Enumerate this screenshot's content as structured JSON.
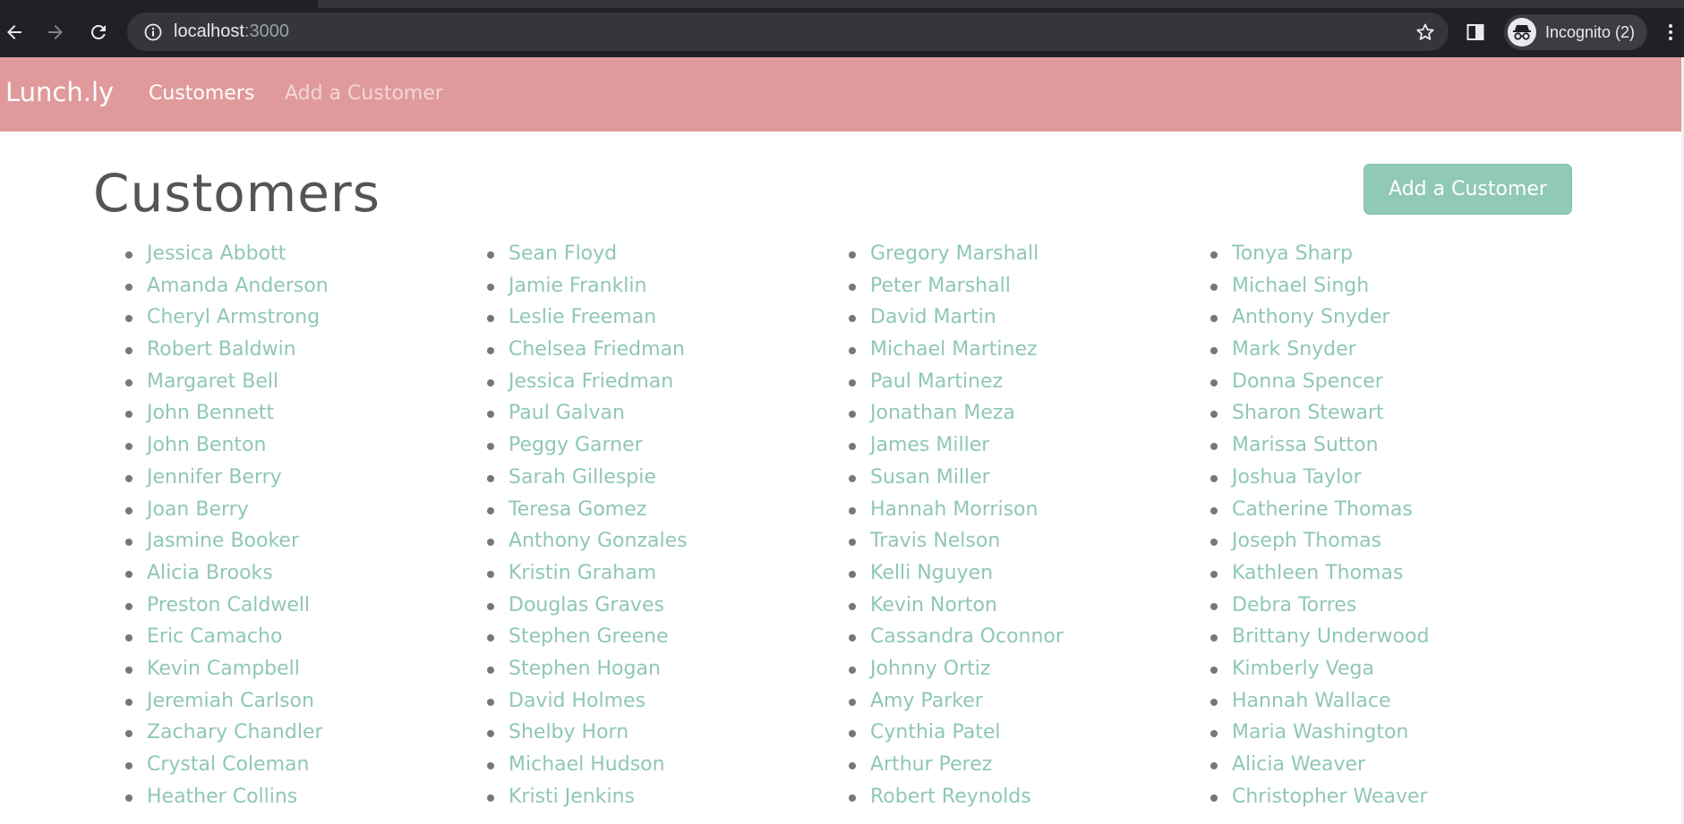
{
  "browser": {
    "url_host": "localhost",
    "url_port": ":3000",
    "incognito_label": "Incognito (2)",
    "icons": [
      "back-arrow-icon",
      "forward-arrow-icon",
      "reload-icon",
      "info-icon",
      "star-icon",
      "side-panel-icon",
      "incognito-icon",
      "kebab-menu-icon"
    ]
  },
  "navbar": {
    "brand": "Lunch.ly",
    "links": [
      {
        "label": "Customers",
        "active": true
      },
      {
        "label": "Add a Customer",
        "active": false
      }
    ]
  },
  "main": {
    "title": "Customers",
    "add_button_label": "Add a Customer",
    "customers": [
      [
        "Jessica Abbott",
        "Amanda Anderson",
        "Cheryl Armstrong",
        "Robert Baldwin",
        "Margaret Bell",
        "John Bennett",
        "John Benton",
        "Jennifer Berry",
        "Joan Berry",
        "Jasmine Booker",
        "Alicia Brooks",
        "Preston Caldwell",
        "Eric Camacho",
        "Kevin Campbell",
        "Jeremiah Carlson",
        "Zachary Chandler",
        "Crystal Coleman",
        "Heather Collins"
      ],
      [
        "Sean Floyd",
        "Jamie Franklin",
        "Leslie Freeman",
        "Chelsea Friedman",
        "Jessica Friedman",
        "Paul Galvan",
        "Peggy Garner",
        "Sarah Gillespie",
        "Teresa Gomez",
        "Anthony Gonzales",
        "Kristin Graham",
        "Douglas Graves",
        "Stephen Greene",
        "Stephen Hogan",
        "David Holmes",
        "Shelby Horn",
        "Michael Hudson",
        "Kristi Jenkins"
      ],
      [
        "Gregory Marshall",
        "Peter Marshall",
        "David Martin",
        "Michael Martinez",
        "Paul Martinez",
        "Jonathan Meza",
        "James Miller",
        "Susan Miller",
        "Hannah Morrison",
        "Travis Nelson",
        "Kelli Nguyen",
        "Kevin Norton",
        "Cassandra Oconnor",
        "Johnny Ortiz",
        "Amy Parker",
        "Cynthia Patel",
        "Arthur Perez",
        "Robert Reynolds"
      ],
      [
        "Tonya Sharp",
        "Michael Singh",
        "Anthony Snyder",
        "Mark Snyder",
        "Donna Spencer",
        "Sharon Stewart",
        "Marissa Sutton",
        "Joshua Taylor",
        "Catherine Thomas",
        "Joseph Thomas",
        "Kathleen Thomas",
        "Debra Torres",
        "Brittany Underwood",
        "Kimberly Vega",
        "Hannah Wallace",
        "Maria Washington",
        "Alicia Weaver",
        "Christopher Weaver"
      ]
    ]
  },
  "colors": {
    "navbar_bg": "#e09a9b",
    "link": "#8fc7b5",
    "button_bg": "#90c9b6",
    "title": "#545454",
    "chrome_bg": "#202124"
  }
}
